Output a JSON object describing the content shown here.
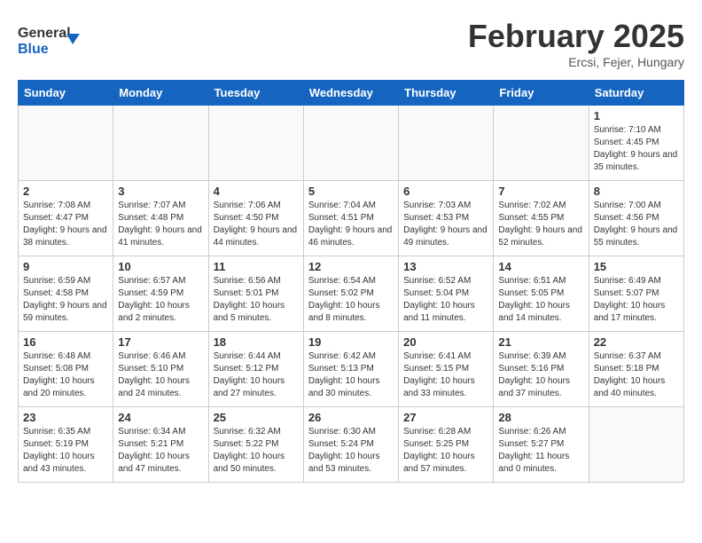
{
  "header": {
    "logo_line1": "General",
    "logo_line2": "Blue",
    "month": "February 2025",
    "location": "Ercsi, Fejer, Hungary"
  },
  "weekdays": [
    "Sunday",
    "Monday",
    "Tuesday",
    "Wednesday",
    "Thursday",
    "Friday",
    "Saturday"
  ],
  "weeks": [
    [
      {
        "day": "",
        "info": ""
      },
      {
        "day": "",
        "info": ""
      },
      {
        "day": "",
        "info": ""
      },
      {
        "day": "",
        "info": ""
      },
      {
        "day": "",
        "info": ""
      },
      {
        "day": "",
        "info": ""
      },
      {
        "day": "1",
        "info": "Sunrise: 7:10 AM\nSunset: 4:45 PM\nDaylight: 9 hours and 35 minutes."
      }
    ],
    [
      {
        "day": "2",
        "info": "Sunrise: 7:08 AM\nSunset: 4:47 PM\nDaylight: 9 hours and 38 minutes."
      },
      {
        "day": "3",
        "info": "Sunrise: 7:07 AM\nSunset: 4:48 PM\nDaylight: 9 hours and 41 minutes."
      },
      {
        "day": "4",
        "info": "Sunrise: 7:06 AM\nSunset: 4:50 PM\nDaylight: 9 hours and 44 minutes."
      },
      {
        "day": "5",
        "info": "Sunrise: 7:04 AM\nSunset: 4:51 PM\nDaylight: 9 hours and 46 minutes."
      },
      {
        "day": "6",
        "info": "Sunrise: 7:03 AM\nSunset: 4:53 PM\nDaylight: 9 hours and 49 minutes."
      },
      {
        "day": "7",
        "info": "Sunrise: 7:02 AM\nSunset: 4:55 PM\nDaylight: 9 hours and 52 minutes."
      },
      {
        "day": "8",
        "info": "Sunrise: 7:00 AM\nSunset: 4:56 PM\nDaylight: 9 hours and 55 minutes."
      }
    ],
    [
      {
        "day": "9",
        "info": "Sunrise: 6:59 AM\nSunset: 4:58 PM\nDaylight: 9 hours and 59 minutes."
      },
      {
        "day": "10",
        "info": "Sunrise: 6:57 AM\nSunset: 4:59 PM\nDaylight: 10 hours and 2 minutes."
      },
      {
        "day": "11",
        "info": "Sunrise: 6:56 AM\nSunset: 5:01 PM\nDaylight: 10 hours and 5 minutes."
      },
      {
        "day": "12",
        "info": "Sunrise: 6:54 AM\nSunset: 5:02 PM\nDaylight: 10 hours and 8 minutes."
      },
      {
        "day": "13",
        "info": "Sunrise: 6:52 AM\nSunset: 5:04 PM\nDaylight: 10 hours and 11 minutes."
      },
      {
        "day": "14",
        "info": "Sunrise: 6:51 AM\nSunset: 5:05 PM\nDaylight: 10 hours and 14 minutes."
      },
      {
        "day": "15",
        "info": "Sunrise: 6:49 AM\nSunset: 5:07 PM\nDaylight: 10 hours and 17 minutes."
      }
    ],
    [
      {
        "day": "16",
        "info": "Sunrise: 6:48 AM\nSunset: 5:08 PM\nDaylight: 10 hours and 20 minutes."
      },
      {
        "day": "17",
        "info": "Sunrise: 6:46 AM\nSunset: 5:10 PM\nDaylight: 10 hours and 24 minutes."
      },
      {
        "day": "18",
        "info": "Sunrise: 6:44 AM\nSunset: 5:12 PM\nDaylight: 10 hours and 27 minutes."
      },
      {
        "day": "19",
        "info": "Sunrise: 6:42 AM\nSunset: 5:13 PM\nDaylight: 10 hours and 30 minutes."
      },
      {
        "day": "20",
        "info": "Sunrise: 6:41 AM\nSunset: 5:15 PM\nDaylight: 10 hours and 33 minutes."
      },
      {
        "day": "21",
        "info": "Sunrise: 6:39 AM\nSunset: 5:16 PM\nDaylight: 10 hours and 37 minutes."
      },
      {
        "day": "22",
        "info": "Sunrise: 6:37 AM\nSunset: 5:18 PM\nDaylight: 10 hours and 40 minutes."
      }
    ],
    [
      {
        "day": "23",
        "info": "Sunrise: 6:35 AM\nSunset: 5:19 PM\nDaylight: 10 hours and 43 minutes."
      },
      {
        "day": "24",
        "info": "Sunrise: 6:34 AM\nSunset: 5:21 PM\nDaylight: 10 hours and 47 minutes."
      },
      {
        "day": "25",
        "info": "Sunrise: 6:32 AM\nSunset: 5:22 PM\nDaylight: 10 hours and 50 minutes."
      },
      {
        "day": "26",
        "info": "Sunrise: 6:30 AM\nSunset: 5:24 PM\nDaylight: 10 hours and 53 minutes."
      },
      {
        "day": "27",
        "info": "Sunrise: 6:28 AM\nSunset: 5:25 PM\nDaylight: 10 hours and 57 minutes."
      },
      {
        "day": "28",
        "info": "Sunrise: 6:26 AM\nSunset: 5:27 PM\nDaylight: 11 hours and 0 minutes."
      },
      {
        "day": "",
        "info": ""
      }
    ]
  ]
}
